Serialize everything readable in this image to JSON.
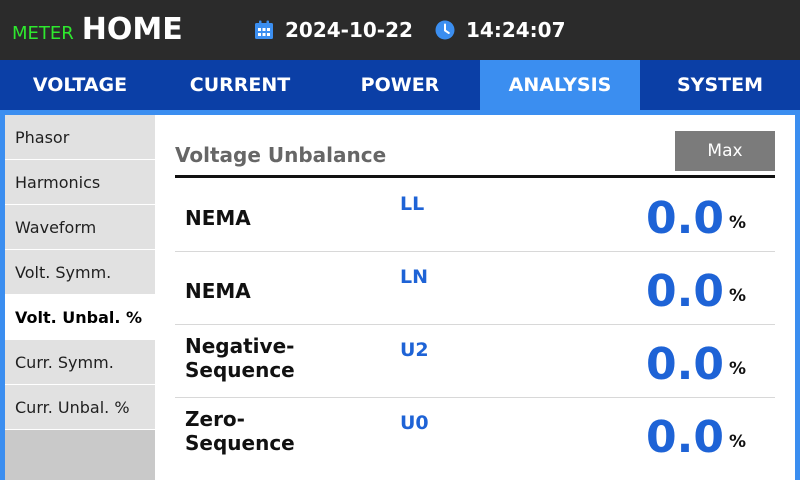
{
  "header": {
    "brand_sub": "METER",
    "brand_main": "HOME",
    "date": "2024-10-22",
    "time": "14:24:07",
    "date_icon": "calendar-icon",
    "time_icon": "clock-icon"
  },
  "tabs": [
    {
      "label": "VOLTAGE"
    },
    {
      "label": "CURRENT"
    },
    {
      "label": "POWER"
    },
    {
      "label": "ANALYSIS",
      "active": true
    },
    {
      "label": "SYSTEM"
    }
  ],
  "sidebar": {
    "items": [
      {
        "label": "Phasor"
      },
      {
        "label": "Harmonics"
      },
      {
        "label": "Waveform"
      },
      {
        "label": "Volt. Symm."
      },
      {
        "label": "Volt. Unbal. %",
        "active": true
      },
      {
        "label": "Curr. Symm."
      },
      {
        "label": "Curr. Unbal. %"
      }
    ]
  },
  "main": {
    "title": "Voltage Unbalance",
    "max_label": "Max",
    "rows": [
      {
        "label": "NEMA",
        "code": "LL",
        "value": "0.0",
        "unit": "%"
      },
      {
        "label": "NEMA",
        "code": "LN",
        "value": "0.0",
        "unit": "%"
      },
      {
        "label": "Negative-\nSequence",
        "code": "U2",
        "value": "0.0",
        "unit": "%"
      },
      {
        "label": "Zero-\nSequence",
        "code": "U0",
        "value": "0.0",
        "unit": "%"
      }
    ]
  },
  "colors": {
    "tab_bar": "#0b3fa6",
    "tab_active": "#3b8ef0",
    "value_blue": "#1e63d6",
    "brand_green": "#2ee82e"
  }
}
